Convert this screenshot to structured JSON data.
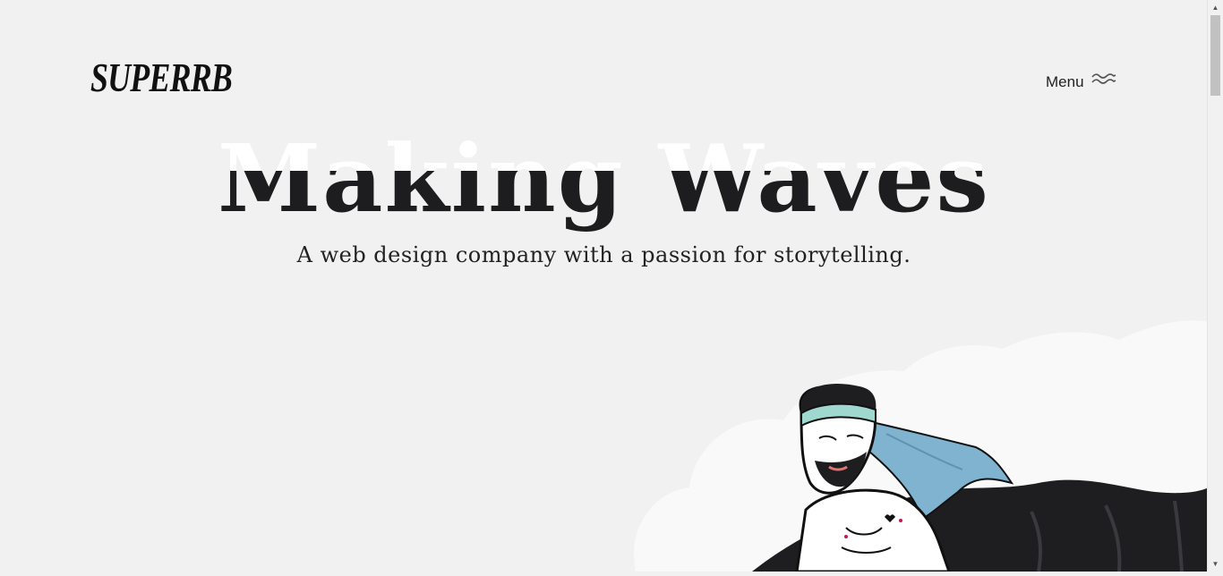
{
  "header": {
    "logo_text": "SUPERRB",
    "menu_label": "Menu",
    "menu_icon": "waves-icon"
  },
  "hero": {
    "title": "Making Waves",
    "subtitle": "A web design company with a passion for storytelling."
  },
  "illustration": {
    "subject": "bearded-man-with-headband-riding-dark-wave-illustration"
  },
  "scrollbar": {
    "up_arrow": "▲",
    "down_arrow": "▼"
  },
  "colors": {
    "background": "#f1f1f1",
    "text": "#1d1d1f",
    "accent_hair": "#7fb3cf",
    "headband": "#9fd8cf"
  }
}
